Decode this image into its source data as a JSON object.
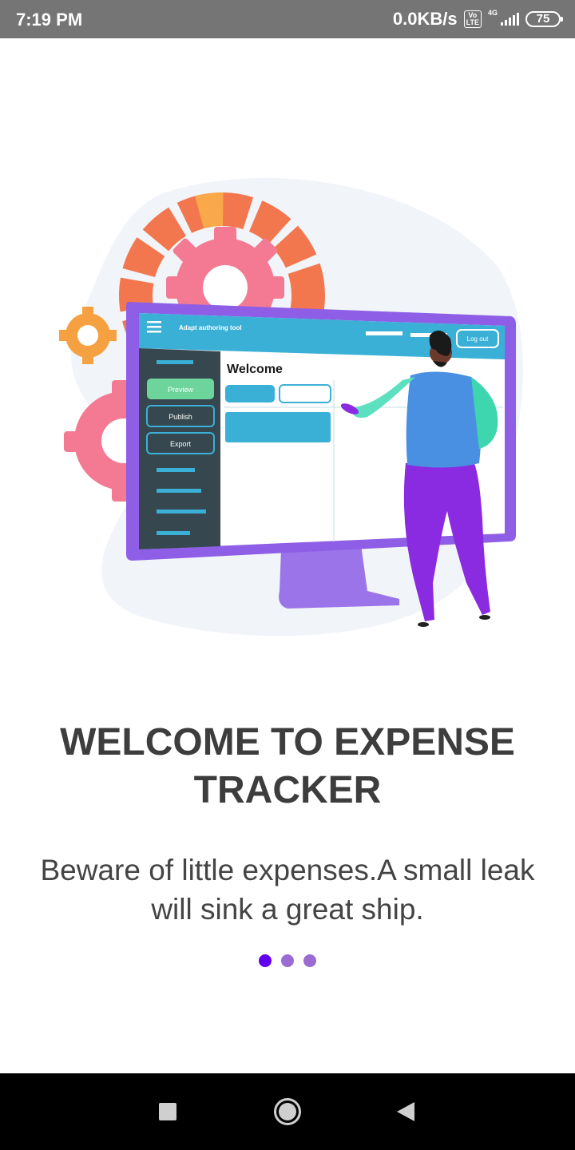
{
  "status_bar": {
    "time": "7:19 PM",
    "net_speed": "0.0KB/s",
    "volte_label": "Vo\nLTE",
    "network_type": "4G",
    "battery_level": "75"
  },
  "illustration": {
    "app_title": "Adapt authoring tool",
    "logout_label": "Log out",
    "welcome_text": "Welcome",
    "preview_label": "Preview",
    "publish_label": "Publish",
    "export_label": "Export"
  },
  "onboarding": {
    "title": "WELCOME TO EXPENSE TRACKER",
    "subtitle": "Beware of little expenses.A small leak will sink a great ship.",
    "pages": 3,
    "active_page": 1
  },
  "colors": {
    "accent": "#6200ee",
    "inactive_dot": "#9a6bd3",
    "status_bar": "#757575",
    "title_text": "#3d3d3d"
  },
  "nav_bar": {
    "recents": "square-icon",
    "home": "home-circle-icon",
    "back": "back-triangle-icon"
  }
}
